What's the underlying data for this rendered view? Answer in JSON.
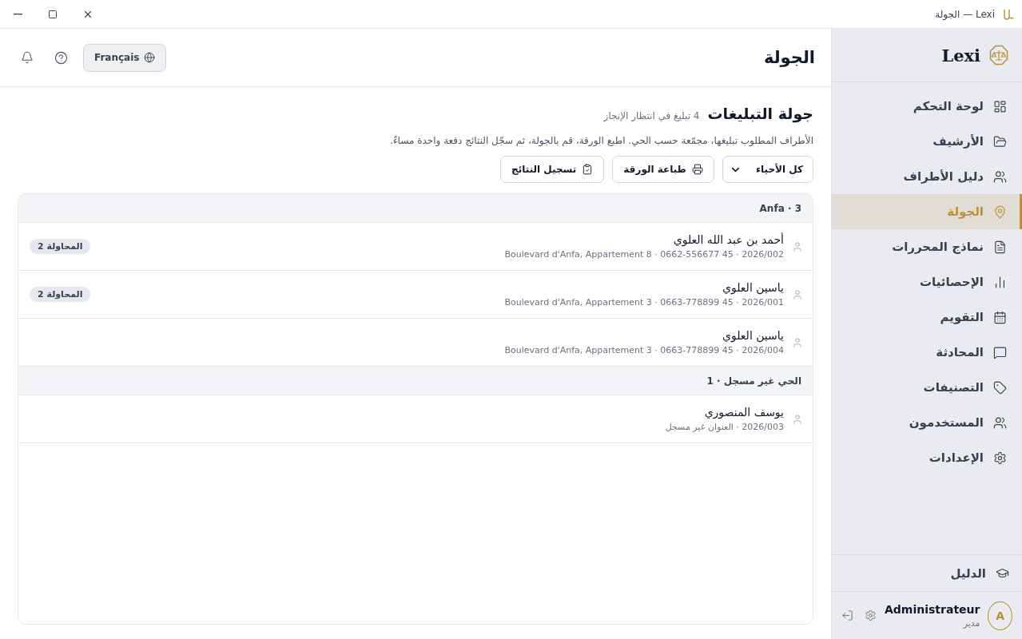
{
  "window": {
    "title": "Lexi — الجولة"
  },
  "sidebar": {
    "brand": "Lexi",
    "items": [
      {
        "label": "لوحة التحكم",
        "selected": false
      },
      {
        "label": "الأرشيف",
        "selected": false
      },
      {
        "label": "دليل الأطراف",
        "selected": false
      },
      {
        "label": "الجولة",
        "selected": true
      },
      {
        "label": "نماذج المحررات",
        "selected": false
      },
      {
        "label": "الإحصائيات",
        "selected": false
      },
      {
        "label": "التقويم",
        "selected": false
      },
      {
        "label": "المحادثة",
        "selected": false
      },
      {
        "label": "التصنيفات",
        "selected": false
      },
      {
        "label": "المستخدمون",
        "selected": false
      },
      {
        "label": "الإعدادات",
        "selected": false
      }
    ],
    "guide": "الدليل",
    "user": {
      "initial": "A",
      "name": "Administrateur",
      "role": "مدير"
    }
  },
  "header": {
    "title": "الجولة",
    "language": "Français"
  },
  "section": {
    "title": "جولة التبليغات",
    "count": "4 تبليغ في انتظار الإنجاز",
    "description": "الأطراف المطلوب تبليغها، مجمّعة حسب الحي. اطبع الورقة، قم بالجولة، ثم سجّل النتائج دفعة واحدة مساءً.",
    "filter": "كل الأحياء",
    "buttons": [
      "طباعة الورقة",
      "تسجيل النتائج"
    ]
  },
  "groups": [
    {
      "header": "Anfa · 3",
      "rows": [
        {
          "name": "أحمد بن عبد الله العلوي",
          "details": "Boulevard d'Anfa, Appartement 8 · 0662-556677 45 · 2026/002",
          "badge": "المحاولة 2"
        },
        {
          "name": "ياسين العلوي",
          "details": "Boulevard d'Anfa, Appartement 3 · 0663-778899 45 · 2026/001",
          "badge": "المحاولة 2"
        },
        {
          "name": "ياسين العلوي",
          "details": "Boulevard d'Anfa, Appartement 3 · 0663-778899 45 · 2026/004"
        }
      ]
    },
    {
      "header": "الحي غير مسجل · 1",
      "rows": [
        {
          "name": "يوسف المنصوري",
          "details": "2026/003 · العنوان غير مسجل"
        }
      ]
    }
  ]
}
